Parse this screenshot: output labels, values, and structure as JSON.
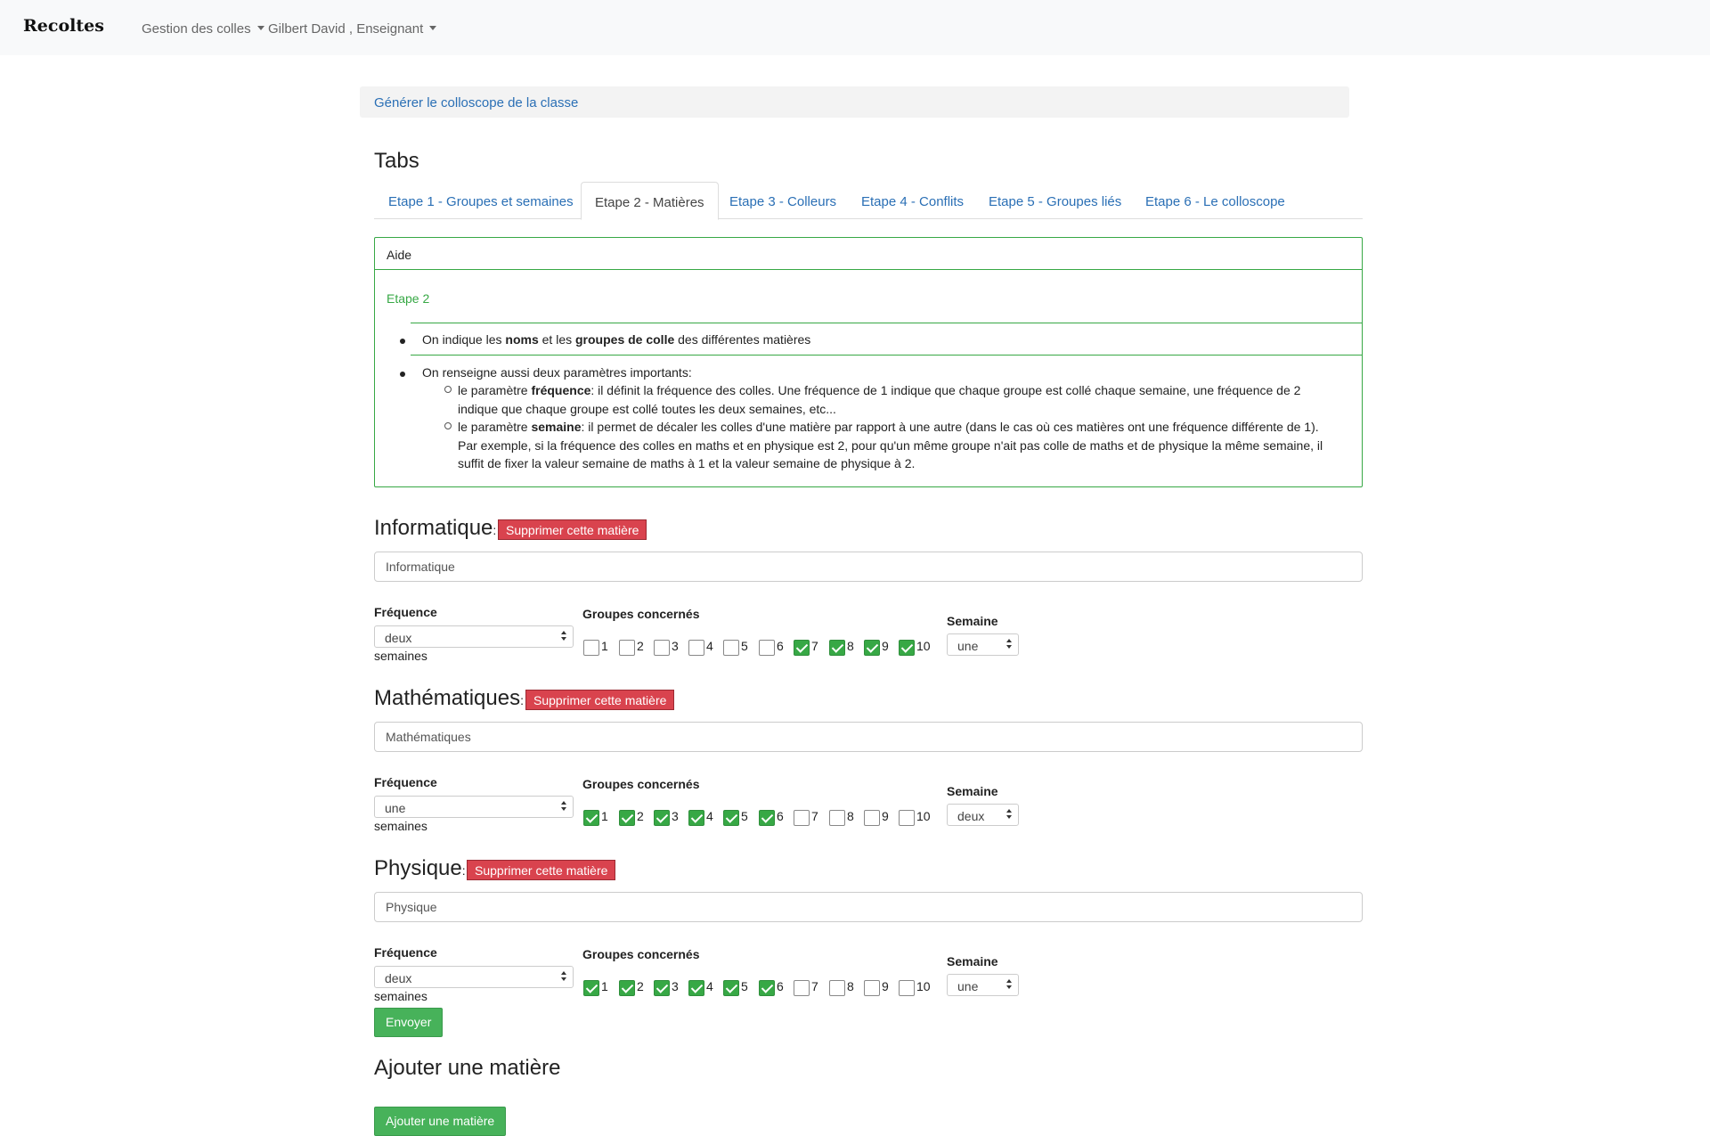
{
  "navbar": {
    "brand": "Recoltes",
    "menu_colles": "Gestion des colles",
    "menu_user": "Gilbert David , Enseignant"
  },
  "breadcrumb": {
    "link": "Générer le colloscope de la classe"
  },
  "tabs": {
    "title": "Tabs",
    "items": [
      {
        "label": "Etape 1 - Groupes et semaines"
      },
      {
        "label": "Etape 2 - Matières"
      },
      {
        "label": "Etape 3 - Colleurs"
      },
      {
        "label": "Etape 4 - Conflits"
      },
      {
        "label": "Etape 5 - Groupes liés"
      },
      {
        "label": "Etape 6 - Le colloscope"
      }
    ],
    "active_index": 1
  },
  "help": {
    "header": "Aide",
    "subtitle": "Etape 2",
    "b1_pre": "On indique les ",
    "b1_bold1": "noms",
    "b1_mid": " et les ",
    "b1_bold2": "groupes de colle",
    "b1_post": " des différentes matières",
    "b2": "On renseigne aussi deux paramètres importants:",
    "s1_pre": "le paramètre ",
    "s1_bold": "fréquence",
    "s1_line1": ": il définit la fréquence des colles. Une fréquence de 1 indique que chaque groupe est collé chaque semaine, une fréquence de 2",
    "s1_line2": "indique que chaque groupe est collé toutes les deux semaines, etc...",
    "s2_pre": "le paramètre ",
    "s2_bold": "semaine",
    "s2_line1": ": il permet de décaler les colles d'une matière par rapport à une autre (dans le cas où ces matières ont une fréquence différente de 1).",
    "s2_line2": "Par exemple, si la fréquence des colles en maths et en physique est 2, pour qu'un même groupe n'ait pas colle de maths et de physique la même semaine, il",
    "s2_line3": "suffit de fixer la valeur semaine de maths à 1 et la valeur semaine de physique à 2."
  },
  "labels": {
    "delete_button": "Supprimer cette matière",
    "frequence": "Fréquence",
    "groupes": "Groupes concernés",
    "semaine": "Semaine",
    "semaines_suffix": "semaines",
    "colon": ":"
  },
  "subjects": [
    {
      "title": "Informatique",
      "name_value": "Informatique",
      "frequence": "deux",
      "semaine": "une",
      "groups": [
        {
          "n": "1",
          "checked": false
        },
        {
          "n": "2",
          "checked": false
        },
        {
          "n": "3",
          "checked": false
        },
        {
          "n": "4",
          "checked": false
        },
        {
          "n": "5",
          "checked": false
        },
        {
          "n": "6",
          "checked": false
        },
        {
          "n": "7",
          "checked": true
        },
        {
          "n": "8",
          "checked": true
        },
        {
          "n": "9",
          "checked": true
        },
        {
          "n": "10",
          "checked": true
        }
      ]
    },
    {
      "title": "Mathématiques",
      "name_value": "Mathématiques",
      "frequence": "une",
      "semaine": "deux",
      "groups": [
        {
          "n": "1",
          "checked": true
        },
        {
          "n": "2",
          "checked": true
        },
        {
          "n": "3",
          "checked": true
        },
        {
          "n": "4",
          "checked": true
        },
        {
          "n": "5",
          "checked": true
        },
        {
          "n": "6",
          "checked": true
        },
        {
          "n": "7",
          "checked": false
        },
        {
          "n": "8",
          "checked": false
        },
        {
          "n": "9",
          "checked": false
        },
        {
          "n": "10",
          "checked": false
        }
      ]
    },
    {
      "title": "Physique",
      "name_value": "Physique",
      "frequence": "deux",
      "semaine": "une",
      "groups": [
        {
          "n": "1",
          "checked": true
        },
        {
          "n": "2",
          "checked": true
        },
        {
          "n": "3",
          "checked": true
        },
        {
          "n": "4",
          "checked": true
        },
        {
          "n": "5",
          "checked": true
        },
        {
          "n": "6",
          "checked": true
        },
        {
          "n": "7",
          "checked": false
        },
        {
          "n": "8",
          "checked": false
        },
        {
          "n": "9",
          "checked": false
        },
        {
          "n": "10",
          "checked": false
        }
      ]
    }
  ],
  "submit_button": "Envoyer",
  "add_section": {
    "title": "Ajouter une matière",
    "button": "Ajouter une matière"
  },
  "colors": {
    "success": "#37a845",
    "danger": "#d9434e",
    "link": "#2a6fb5"
  }
}
